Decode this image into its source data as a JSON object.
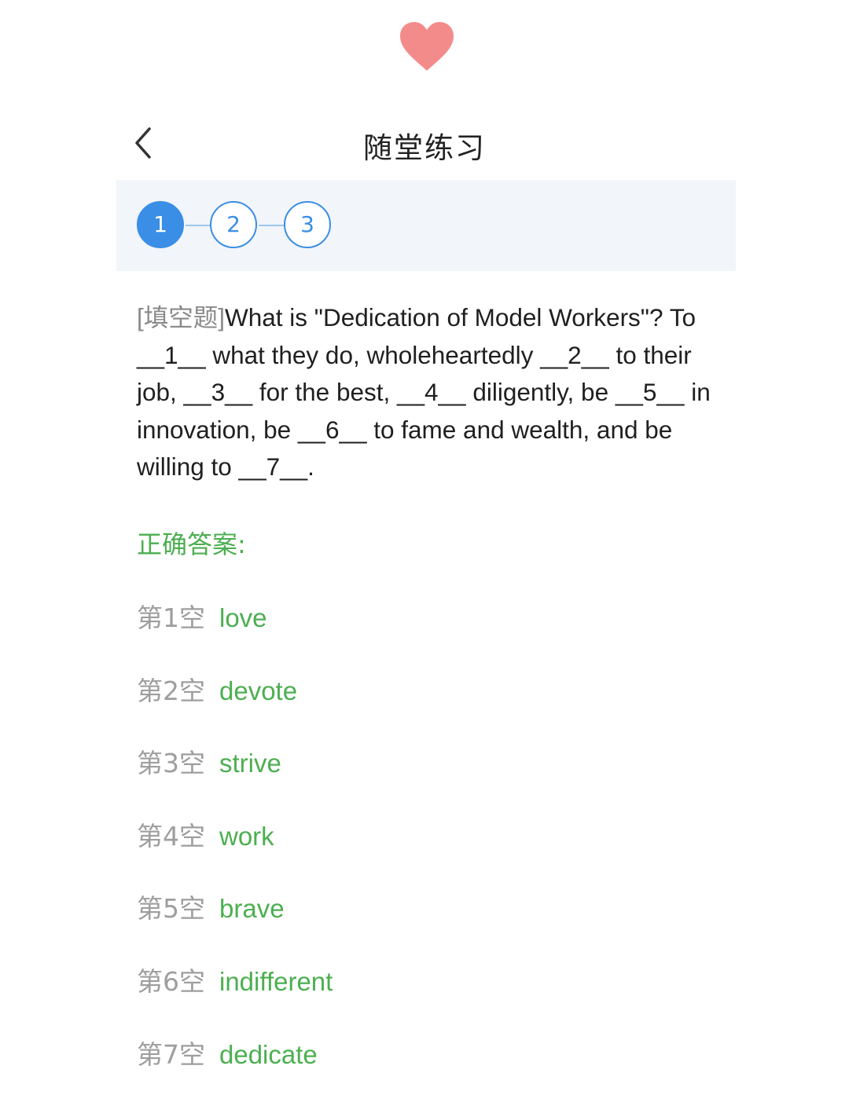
{
  "header": {
    "title": "随堂练习",
    "back_icon": "chevron-left-icon"
  },
  "decoration": {
    "icon": "heart-icon",
    "color": "#f48b8b"
  },
  "steps": [
    {
      "label": "1",
      "active": true
    },
    {
      "label": "2",
      "active": false
    },
    {
      "label": "3",
      "active": false
    }
  ],
  "question": {
    "type_label": "[填空题]",
    "text": "What is \"Dedication of Model Workers\"? To __1__ what they do, wholeheartedly __2__ to their job, __3__ for the best, __4__ diligently, be __5__ in innovation, be __6__ to fame and wealth, and be willing to __7__."
  },
  "answer_section": {
    "title": "正确答案:",
    "items": [
      {
        "label": "第1空",
        "answer": "love"
      },
      {
        "label": "第2空",
        "answer": "devote"
      },
      {
        "label": "第3空",
        "answer": "strive"
      },
      {
        "label": "第4空",
        "answer": "work"
      },
      {
        "label": "第5空",
        "answer": "brave"
      },
      {
        "label": "第6空",
        "answer": "indifferent"
      },
      {
        "label": "第7空",
        "answer": "dedicate"
      }
    ]
  },
  "colors": {
    "accent_blue": "#3a8ee6",
    "answer_green": "#4caf50",
    "label_gray": "#9e9e9e",
    "step_bar_bg": "#f2f5fa"
  }
}
